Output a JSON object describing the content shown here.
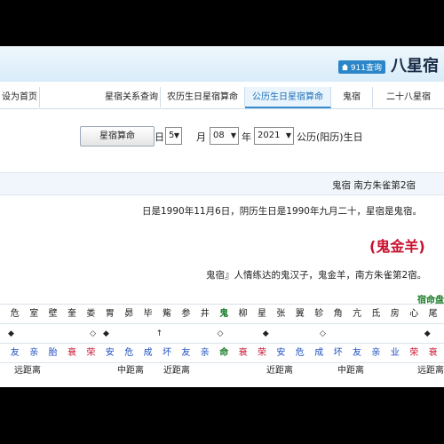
{
  "header": {
    "site_title": "八星宿",
    "badge": "911查询"
  },
  "nav": {
    "tabs": [
      "设为首页",
      "二十八星宿",
      "鬼宿",
      "公历生日星宿算命",
      "农历生日星宿算命",
      "星宿关系查询"
    ]
  },
  "form": {
    "label_prefix": "公历(阳历)生日",
    "year_value": "2021",
    "year_unit": "年",
    "month_value": "08",
    "month_unit": "月",
    "day_value": "5",
    "day_unit": "日",
    "submit_label": "星宿算命"
  },
  "section": {
    "heading": "鬼宿 南方朱雀第2宿",
    "birth_info": "日是1990年11月6日，阴历生日是1990年九月二十，星宿是鬼宿。",
    "result_title": "(鬼金羊)",
    "desc": "鬼宿』人情练达的鬼汉子，鬼金羊，南方朱雀第2宿。",
    "table_caption": "宿命盘"
  },
  "table": {
    "mansions": [
      "尾",
      "心",
      "房",
      "氐",
      "亢",
      "角",
      "轸",
      "翼",
      "张",
      "星",
      "柳",
      "鬼",
      "井",
      "参",
      "觜",
      "毕",
      "昴",
      "胃",
      "娄",
      "奎",
      "壁",
      "室",
      "危"
    ],
    "relations": [
      "衰",
      "荣",
      "业",
      "亲",
      "友",
      "坏",
      "成",
      "危",
      "安",
      "荣",
      "衰",
      "命",
      "亲",
      "友",
      "坏",
      "成",
      "危",
      "安",
      "荣",
      "衰",
      "胎",
      "亲",
      "友"
    ],
    "markers": [
      "◆",
      "◇",
      "◆",
      "◇",
      "↑",
      "◆",
      "◇",
      "◆"
    ],
    "distances": [
      "远距离",
      "中距离",
      "近距离",
      "近距离",
      "中距离",
      "远距离"
    ]
  },
  "colors": {
    "accent": "#1d6fb8",
    "red": "#c8102e",
    "green": "#1b7e2a",
    "blue": "#1e4fbf"
  }
}
